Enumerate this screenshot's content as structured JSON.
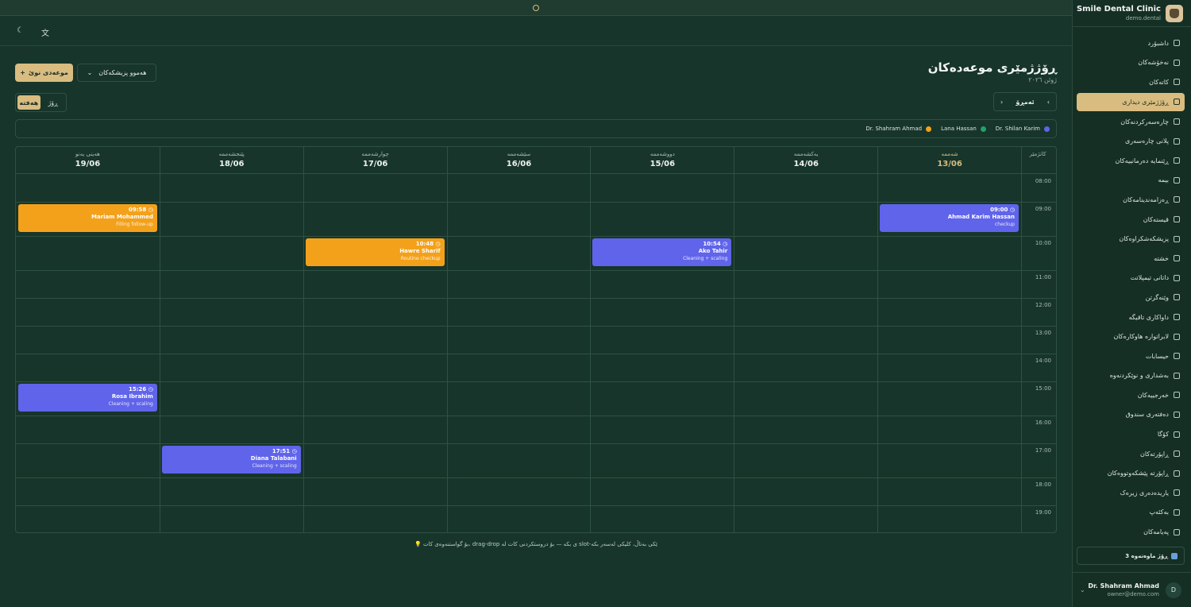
{
  "brand": {
    "name": "Smile Dental Clinic",
    "domain": "demo.dental"
  },
  "nav": [
    {
      "label": "داشبۆرد",
      "icon": "grid-icon",
      "name": "nav-dashboard"
    },
    {
      "label": "نەخۆشەکان",
      "icon": "users-icon",
      "name": "nav-patients"
    },
    {
      "label": "کاتەکان",
      "icon": "calendar-icon",
      "name": "nav-appointments"
    },
    {
      "label": "ڕۆژژمێری دیداری",
      "icon": "calendar-icon",
      "name": "nav-visit-calendar",
      "active": true
    },
    {
      "label": "چارەسەرکردنەکان",
      "icon": "clipboard-icon",
      "name": "nav-treatments"
    },
    {
      "label": "پلانی چارەسەری",
      "icon": "clipboard-icon",
      "name": "nav-treatment-plan"
    },
    {
      "label": "ڕێنمایە دەرمانییەکان",
      "icon": "pill-icon",
      "name": "nav-prescriptions"
    },
    {
      "label": "بیمە",
      "icon": "shield-icon",
      "name": "nav-insurance"
    },
    {
      "label": "ڕەزامەندینامەکان",
      "icon": "file-sign-icon",
      "name": "nav-consents"
    },
    {
      "label": "قیستەکان",
      "icon": "receipt-icon",
      "name": "nav-installments"
    },
    {
      "label": "پزیشکەشکراوەکان",
      "icon": "user-plus-icon",
      "name": "nav-referrals"
    },
    {
      "label": "خشتە",
      "icon": "calendar-icon",
      "name": "nav-schedule"
    },
    {
      "label": "داتانی تیمپلاتت",
      "icon": "tooth-icon",
      "name": "nav-templates"
    },
    {
      "label": "وێنەگرتن",
      "icon": "image-icon",
      "name": "nav-imaging"
    },
    {
      "label": "داواکاری تاقیگە",
      "icon": "flask-icon",
      "name": "nav-lab-orders"
    },
    {
      "label": "لابراتوارە هاوکارەکان",
      "icon": "building-icon",
      "name": "nav-partner-labs"
    },
    {
      "label": "حیسابات",
      "icon": "calculator-icon",
      "name": "nav-accounts"
    },
    {
      "label": "بەشداری و نوێکردنەوە",
      "icon": "receipt-icon",
      "name": "nav-subscriptions"
    },
    {
      "label": "خەرجییەکان",
      "icon": "wallet-icon",
      "name": "nav-expenses"
    },
    {
      "label": "دەفتەری سندوق",
      "icon": "book-icon",
      "name": "nav-cashbook"
    },
    {
      "label": "کۆگا",
      "icon": "box-icon",
      "name": "nav-inventory"
    },
    {
      "label": "ڕاپۆرتەکان",
      "icon": "bar-chart-icon",
      "name": "nav-reports"
    },
    {
      "label": "ڕاپۆرتە پێشکەوتووەکان",
      "icon": "trend-icon",
      "name": "nav-advanced-reports"
    },
    {
      "label": "یاریدەدەری زیرەک",
      "icon": "brain-icon",
      "name": "nav-ai-assistant"
    },
    {
      "label": "بەکئەپ",
      "icon": "database-icon",
      "name": "nav-backup"
    },
    {
      "label": "پەیامەکان",
      "icon": "message-icon",
      "name": "nav-messages"
    }
  ],
  "trial": {
    "label": "3 ڕۆژ ماوەتەوە"
  },
  "user": {
    "name": "Dr. Shahram Ahmad",
    "email": "owner@demo.com",
    "initial": "D"
  },
  "header": {
    "title": "ڕۆژژمێری موعەدەکان",
    "subtitle": "ژوئن ٢٠٢٦"
  },
  "actions": {
    "new_appointment": "موعەدی نوێ",
    "doctor_filter": "هەموو پزیشکەکان",
    "plus": "+",
    "chevron": "⌄"
  },
  "view": {
    "day": "ڕۆژ",
    "week": "هەفتە",
    "active": "week"
  },
  "date_nav": {
    "today": "ئەمڕۆ",
    "prev": "‹",
    "next": "›"
  },
  "legend": [
    {
      "name": "Dr. Shilan Karim",
      "color": "#6064ea"
    },
    {
      "name": "Lana Hassan",
      "color": "#22a06b"
    },
    {
      "name": "Dr. Shahram Ahmad",
      "color": "#f3a11b"
    }
  ],
  "calendar": {
    "time_header": "کاتژمێر",
    "days": [
      {
        "name": "شەممە",
        "date": "13/06",
        "today": true
      },
      {
        "name": "یەکشەممە",
        "date": "14/06"
      },
      {
        "name": "دووشەممە",
        "date": "15/06"
      },
      {
        "name": "سێشەممە",
        "date": "16/06"
      },
      {
        "name": "چوارشەممە",
        "date": "17/06"
      },
      {
        "name": "پێنجشەممە",
        "date": "18/06"
      },
      {
        "name": "هەینی یەنو",
        "date": "19/06"
      }
    ],
    "hours": [
      "08:00",
      "09:00",
      "10:00",
      "11:00",
      "12:00",
      "13:00",
      "14:00",
      "15:00",
      "16:00",
      "17:00",
      "18:00",
      "19:00"
    ],
    "appointments": [
      {
        "day": 0,
        "hour": "09:00",
        "time": "09:00",
        "patient": "Ahmad Karim Hassan",
        "kind": "checkup",
        "color": "#6064ea"
      },
      {
        "day": 6,
        "hour": "09:00",
        "time": "09:58",
        "patient": "Mariam Mohammed",
        "kind": "Filling follow-up",
        "color": "#f3a11b"
      },
      {
        "day": 2,
        "hour": "10:00",
        "time": "10:54",
        "patient": "Ako Tahir",
        "kind": "Cleaning + scaling",
        "color": "#6064ea"
      },
      {
        "day": 4,
        "hour": "10:00",
        "time": "10:48",
        "patient": "Hawre Sharif",
        "kind": "Routine checkup",
        "color": "#f3a11b"
      },
      {
        "day": 6,
        "hour": "15:00",
        "time": "15:26",
        "patient": "Rosa Ibrahim",
        "kind": "Cleaning + scaling",
        "color": "#6064ea"
      },
      {
        "day": 5,
        "hour": "17:00",
        "time": "17:51",
        "patient": "Diana Talabani",
        "kind": "Cleaning + scaling",
        "color": "#6064ea"
      }
    ]
  },
  "hint": "💡 بۆ گواستنەوەی کات، drag-drop ی بکە — بۆ دروستکردنی کات لە slot-ێکی بەتاڵ، کلیکی لەسەر بکە",
  "icons": {
    "theme": "moon-icon",
    "language": "translate-icon",
    "warning": "alert-icon",
    "clock": "clock-icon"
  }
}
